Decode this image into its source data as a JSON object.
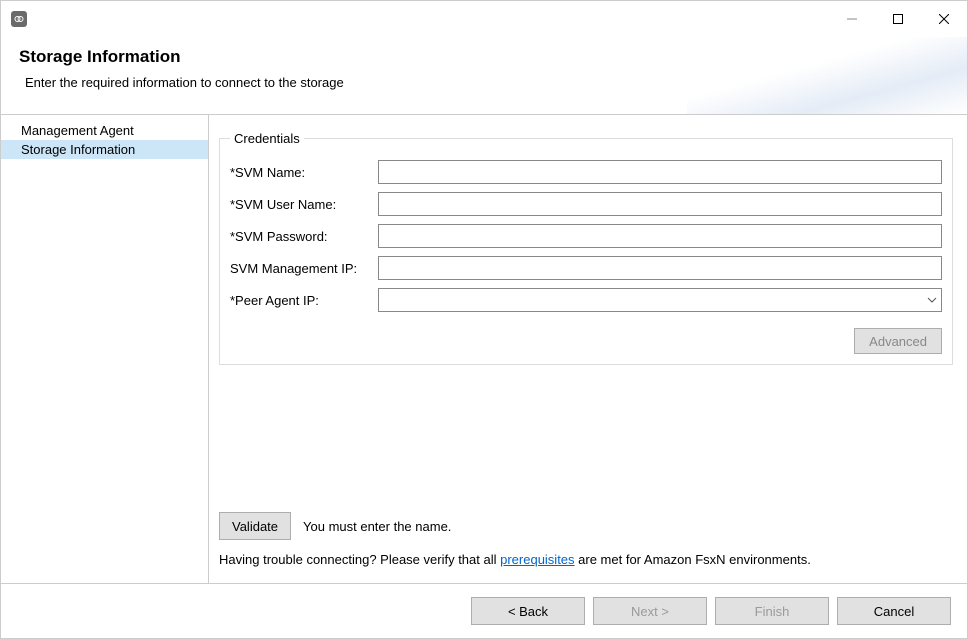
{
  "window": {
    "title": ""
  },
  "banner": {
    "title": "Storage Information",
    "subtitle": "Enter the required information to connect to the storage"
  },
  "sidebar": {
    "items": [
      {
        "label": "Management Agent",
        "selected": false
      },
      {
        "label": "Storage Information",
        "selected": true
      }
    ]
  },
  "credentials": {
    "legend": "Credentials",
    "fields": {
      "svm_name": {
        "label": "*SVM Name:",
        "value": ""
      },
      "svm_user": {
        "label": "*SVM User Name:",
        "value": ""
      },
      "svm_password": {
        "label": "*SVM Password:",
        "value": ""
      },
      "svm_mgmt_ip": {
        "label": "SVM Management IP:",
        "value": ""
      },
      "peer_agent_ip": {
        "label": "*Peer Agent IP:",
        "value": ""
      }
    },
    "advanced_label": "Advanced"
  },
  "validate": {
    "button": "Validate",
    "message": "You must enter the name."
  },
  "help": {
    "prefix": "Having trouble connecting? Please verify that all ",
    "link": "prerequisites",
    "suffix": " are met for Amazon FsxN environments."
  },
  "footer": {
    "back": "< Back",
    "next": "Next >",
    "finish": "Finish",
    "cancel": "Cancel"
  }
}
